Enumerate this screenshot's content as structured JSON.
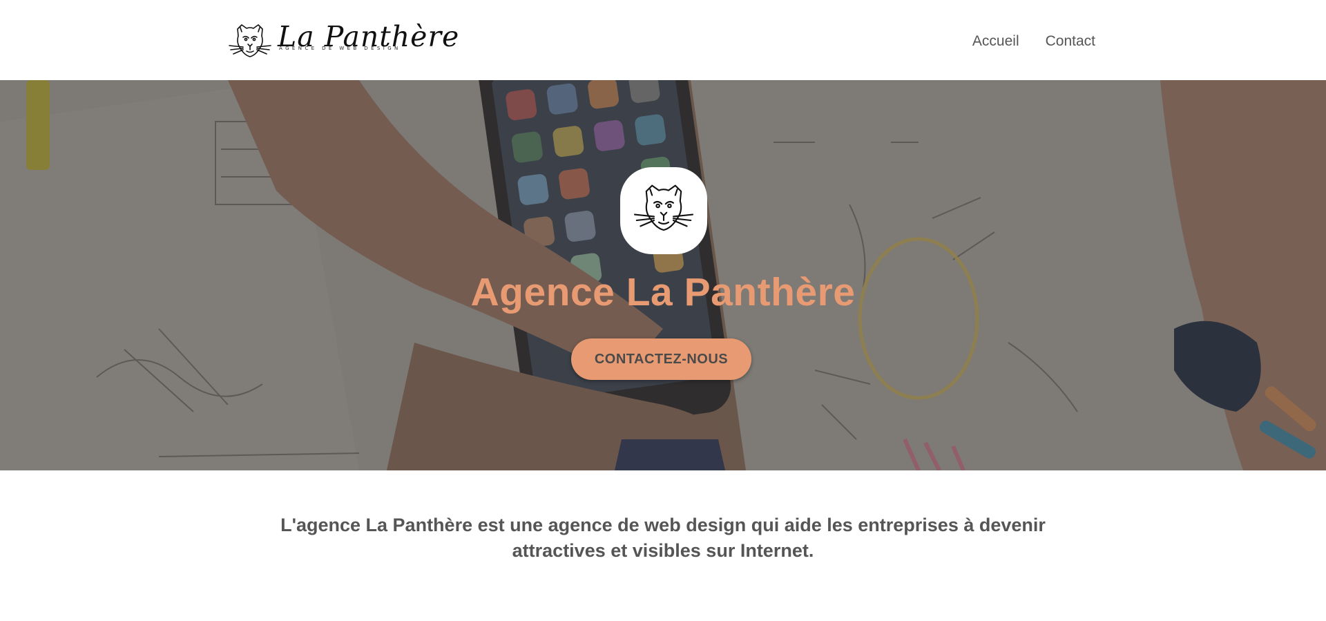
{
  "brand": {
    "name": "La Panthère",
    "tagline": "AGENCE DE WEB DESIGN",
    "logo_icon": "panther-head-icon"
  },
  "nav": {
    "items": [
      {
        "label": "Accueil"
      },
      {
        "label": "Contact"
      }
    ]
  },
  "hero": {
    "title": "Agence La Panthère",
    "cta_label": "CONTACTEZ-NOUS",
    "logo_icon": "panther-head-icon"
  },
  "intro": {
    "text": "L'agence La Panthère est une agence de web design qui aide les entreprises à devenir attractives et visibles sur Internet."
  },
  "colors": {
    "accent": "#e89b72",
    "text": "#555555",
    "background": "#ffffff"
  }
}
